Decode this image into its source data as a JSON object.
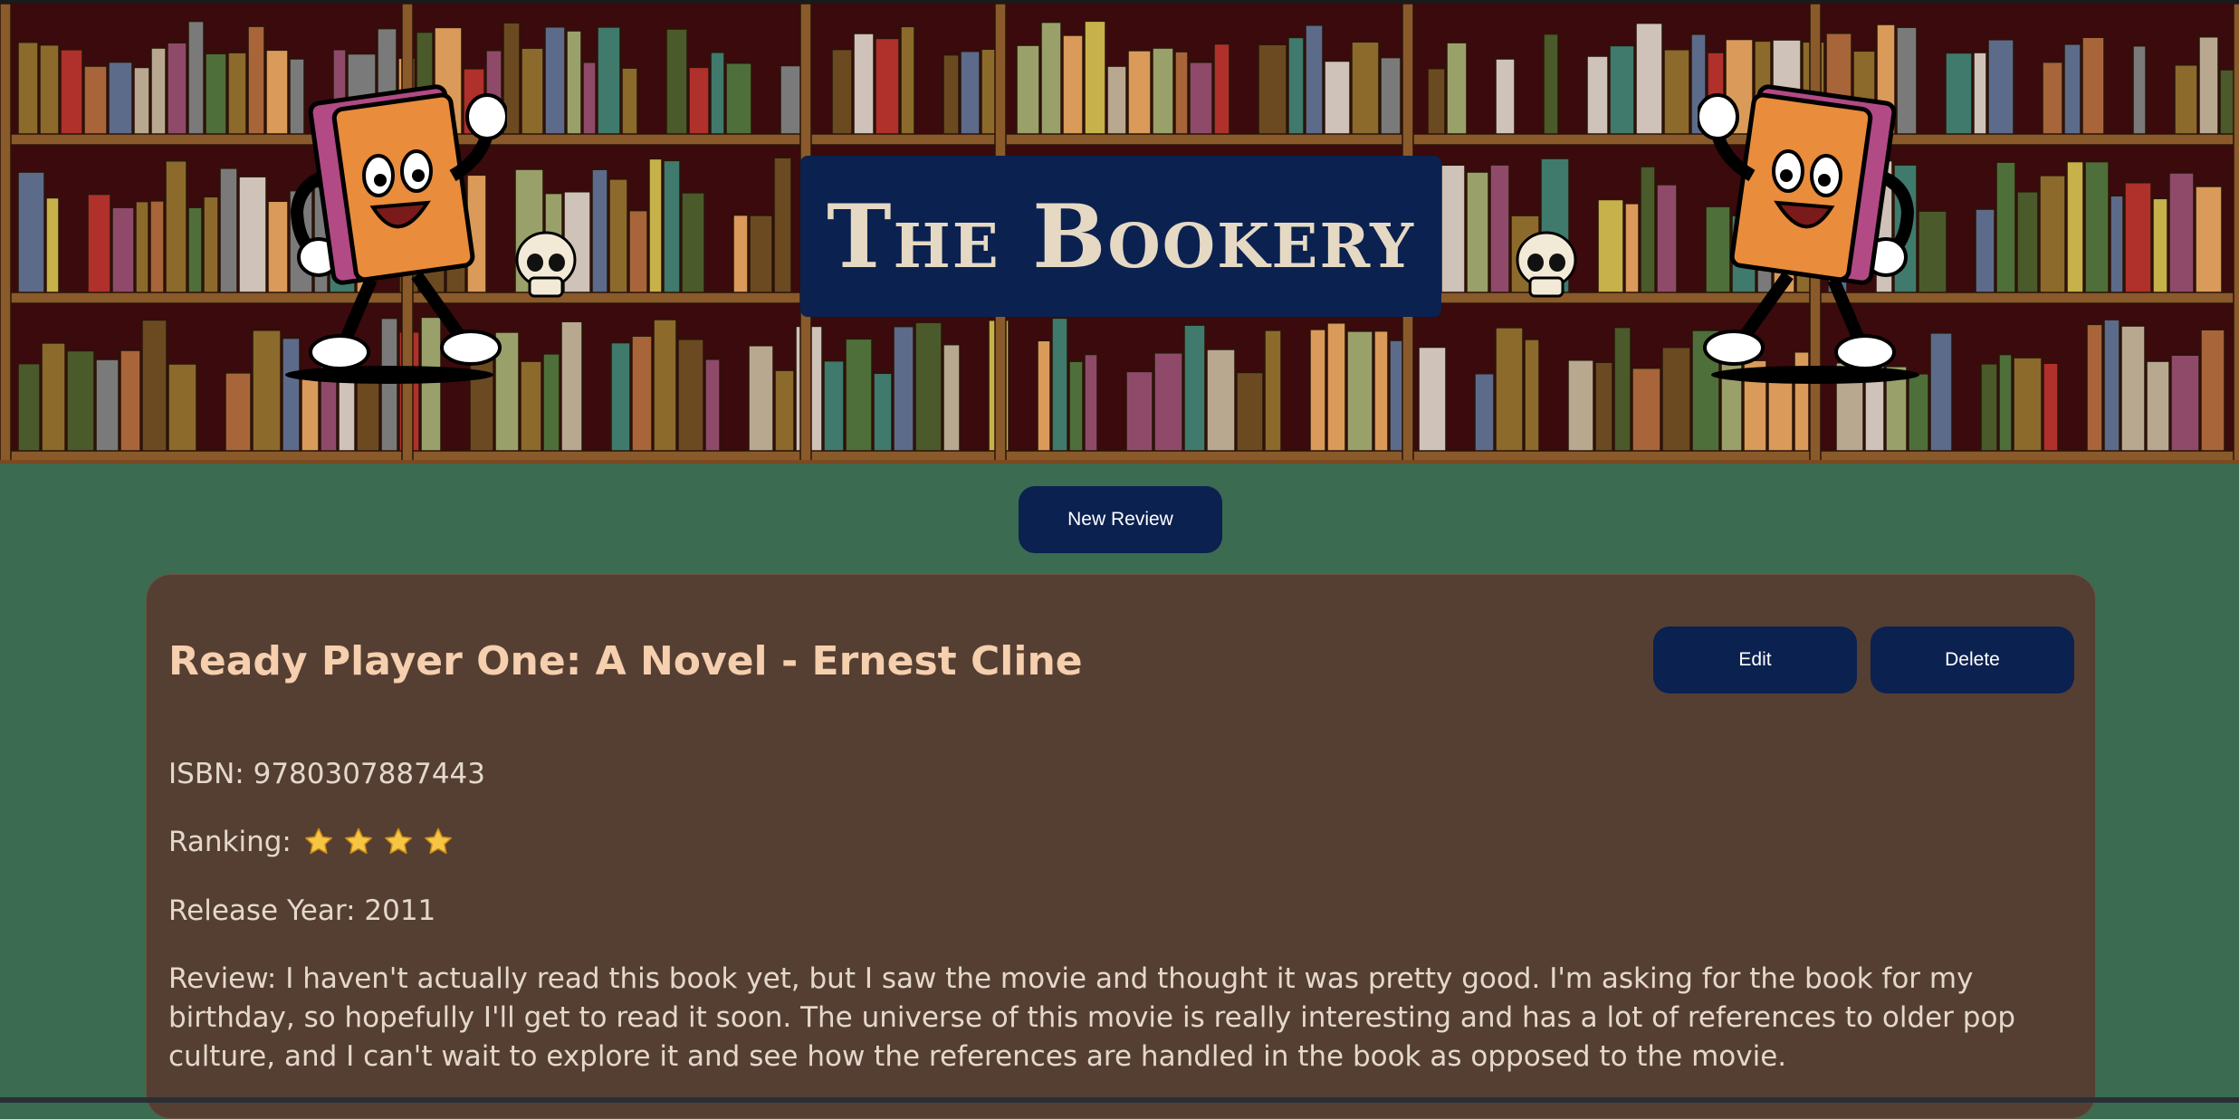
{
  "header": {
    "title": "The Bookery"
  },
  "actions": {
    "new_review_label": "New Review"
  },
  "review": {
    "title": "Ready Player One: A Novel - Ernest Cline",
    "edit_label": "Edit",
    "delete_label": "Delete",
    "isbn_label": "ISBN:",
    "isbn_value": "9780307887443",
    "ranking_label": "Ranking:",
    "ranking_stars": 4,
    "release_label": "Release Year:",
    "release_value": "2011",
    "review_label": "Review:",
    "review_text": "I haven't actually read this book yet, but I saw the movie and thought it was pretty good. I'm asking for the book for my birthday, so hopefully I'll get to read it soon. The universe of this movie is really interesting and has a lot of references to older pop culture, and I can't wait to explore it and see how the references are handled in the book as opposed to the movie."
  },
  "colors": {
    "page_background": "#3b6b50",
    "banner_background": "#3a0a0c",
    "button_background": "#0b2150",
    "card_background": "#553f32",
    "title_color": "#f5cfae",
    "star_color": "#f6c544"
  },
  "icons": {
    "star": "star-icon",
    "mascot": "book-mascot-icon",
    "skull": "skull-icon"
  }
}
